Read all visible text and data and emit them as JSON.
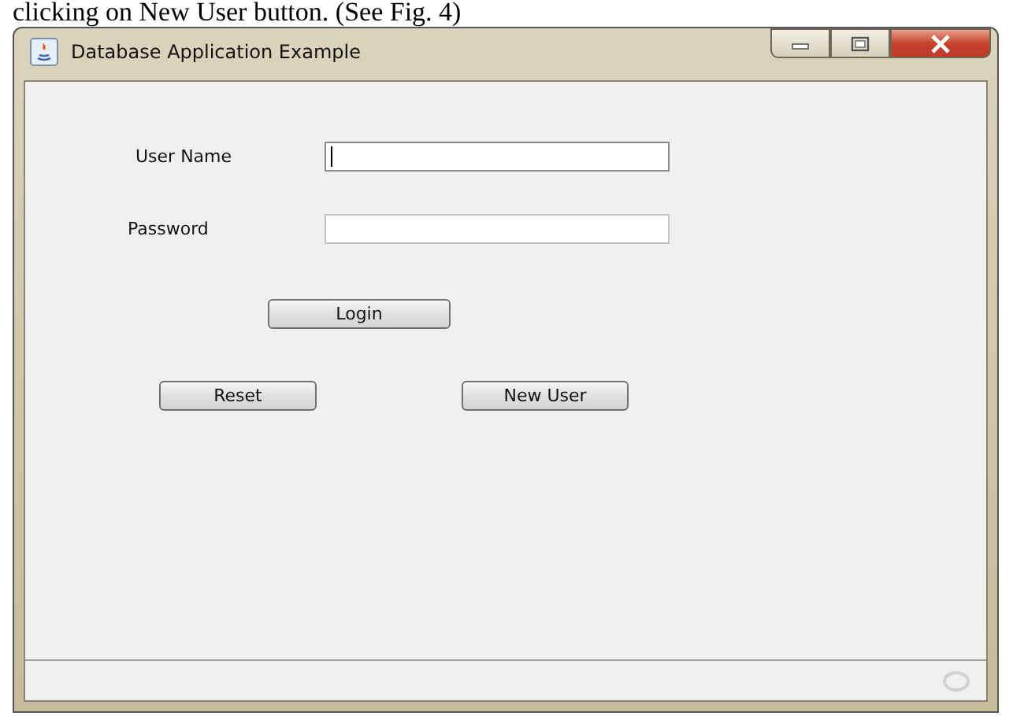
{
  "caption": "clicking on New User button. (See Fig. 4)",
  "window": {
    "title": "Database Application Example"
  },
  "fields": [
    {
      "label": "User Name",
      "focused": true
    },
    {
      "label": "Password",
      "focused": false
    }
  ],
  "buttons": [
    {
      "label": "Login"
    },
    {
      "label": "Reset"
    },
    {
      "label": "New User"
    }
  ]
}
